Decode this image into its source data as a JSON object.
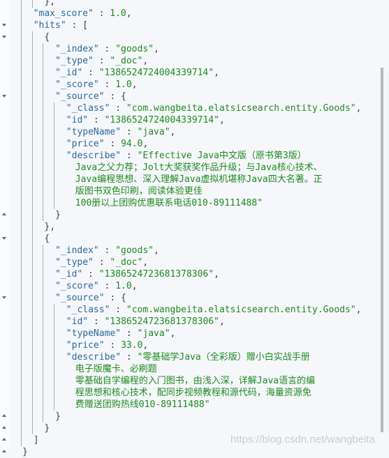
{
  "lines": [
    {
      "d": 2,
      "p": "},"
    },
    {
      "d": 1,
      "k": "\"max_score\"",
      "v": "1.0",
      "t": "n",
      "p": ","
    },
    {
      "d": 1,
      "k": "\"hits\"",
      "p": "[",
      "fold": "down"
    },
    {
      "d": 2,
      "p": "{",
      "fold": "down"
    },
    {
      "d": 3,
      "k": "\"_index\"",
      "v": "\"goods\"",
      "t": "s",
      "p": ","
    },
    {
      "d": 3,
      "k": "\"_type\"",
      "v": "\"_doc\"",
      "t": "s",
      "p": ","
    },
    {
      "d": 3,
      "k": "\"_id\"",
      "v": "\"1386524724004339714\"",
      "t": "s",
      "p": ","
    },
    {
      "d": 3,
      "k": "\"_score\"",
      "v": "1.0",
      "t": "n",
      "p": ","
    },
    {
      "d": 3,
      "k": "\"_source\"",
      "p": "{",
      "fold": "down"
    },
    {
      "d": 4,
      "k": "\"_class\"",
      "v": "\"com.wangbeita.elatsicsearch.entity.Goods\"",
      "t": "s",
      "p": ","
    },
    {
      "d": 4,
      "k": "\"id\"",
      "v": "\"1386524724004339714\"",
      "t": "s",
      "p": ","
    },
    {
      "d": 4,
      "k": "\"typeName\"",
      "v": "\"java\"",
      "t": "s",
      "p": ","
    },
    {
      "d": 4,
      "k": "\"price\"",
      "v": "94.0",
      "t": "n",
      "p": ","
    },
    {
      "d": 4,
      "k": "\"describe\"",
      "v": "\"Effective Java中文版（原书第3版）",
      "t": "s"
    },
    {
      "d": 4,
      "cont": true,
      "v": "Java之父力荐；Jolt大奖获奖作品升级；与Java核心技术、",
      "t": "s"
    },
    {
      "d": 4,
      "cont": true,
      "v": "Java编程思想、深入理解Java虚拟机堪称Java四大名著。正",
      "t": "s"
    },
    {
      "d": 4,
      "cont": true,
      "v": "版图书双色印刷，阅读体验更佳",
      "t": "s"
    },
    {
      "d": 4,
      "cont": true,
      "v": "100册以上团购优惠联系电话010-89111488\"",
      "t": "s"
    },
    {
      "d": 3,
      "p": "}",
      "fold": "up"
    },
    {
      "d": 2,
      "p": "},"
    },
    {
      "d": 2,
      "p": "{",
      "fold": "down"
    },
    {
      "d": 3,
      "k": "\"_index\"",
      "v": "\"goods\"",
      "t": "s",
      "p": ","
    },
    {
      "d": 3,
      "k": "\"_type\"",
      "v": "\"_doc\"",
      "t": "s",
      "p": ","
    },
    {
      "d": 3,
      "k": "\"_id\"",
      "v": "\"1386524723681378306\"",
      "t": "s",
      "p": ","
    },
    {
      "d": 3,
      "k": "\"_score\"",
      "v": "1.0",
      "t": "n",
      "p": ","
    },
    {
      "d": 3,
      "k": "\"_source\"",
      "p": "{",
      "fold": "down"
    },
    {
      "d": 4,
      "k": "\"_class\"",
      "v": "\"com.wangbeita.elatsicsearch.entity.Goods\"",
      "t": "s",
      "p": ","
    },
    {
      "d": 4,
      "k": "\"id\"",
      "v": "\"1386524723681378306\"",
      "t": "s",
      "p": ","
    },
    {
      "d": 4,
      "k": "\"typeName\"",
      "v": "\"java\"",
      "t": "s",
      "p": ","
    },
    {
      "d": 4,
      "k": "\"price\"",
      "v": "33.0",
      "t": "n",
      "p": ","
    },
    {
      "d": 4,
      "k": "\"describe\"",
      "v": "\"零基础学Java（全彩版）赠小白实战手册",
      "t": "s"
    },
    {
      "d": 4,
      "cont": true,
      "v": "电子版魔卡、必刷题",
      "t": "s"
    },
    {
      "d": 4,
      "cont": true,
      "v": "零基础自学编程的入门图书，由浅入深，详解Java语言的编",
      "t": "s"
    },
    {
      "d": 4,
      "cont": true,
      "v": "程思想和核心技术，配同步视频教程和源代码，海量资源免",
      "t": "s"
    },
    {
      "d": 4,
      "cont": true,
      "v": "费赠送团购热线010-89111488\"",
      "t": "s"
    },
    {
      "d": 3,
      "p": "}",
      "fold": "up"
    },
    {
      "d": 2,
      "p": "}",
      "fold": "up"
    },
    {
      "d": 1,
      "p": "]",
      "fold": "up"
    },
    {
      "d": 0,
      "p": "}",
      "fold": "up"
    }
  ],
  "watermark": "https://blog.csdn.net/wangbeita",
  "colors": {
    "key": "#2b6a9a",
    "string": "#1f8a1f",
    "background": "#f5f7fb"
  }
}
